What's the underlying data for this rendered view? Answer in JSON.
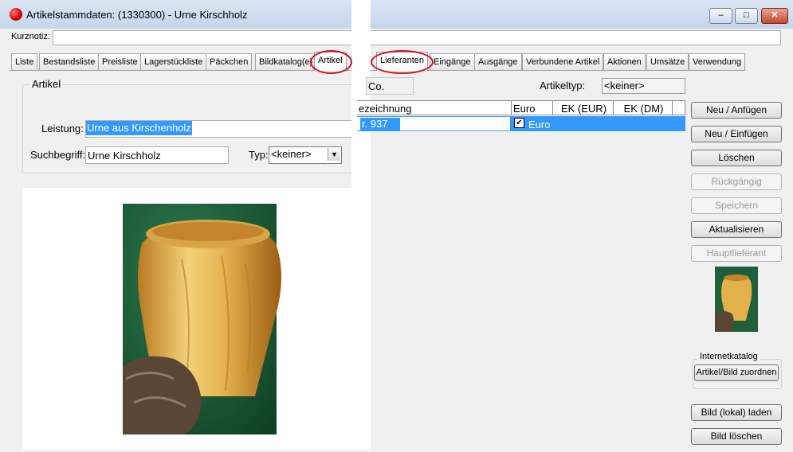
{
  "window": {
    "title": "Artikelstammdaten:  (1330300) - Urne Kirschholz",
    "controls": {
      "minimize": "–",
      "maximize": "□",
      "close": "✕"
    }
  },
  "kurznotiz": {
    "label": "Kurznotiz:",
    "value": ""
  },
  "tabs_left": [
    "Liste",
    "Bestandsliste",
    "Preisliste",
    "Lagerstückliste",
    "Päckchen",
    "Bildkatalog(e)",
    "Artikel"
  ],
  "tabs_right": [
    "Lieferanten",
    "Eingänge",
    "Ausgänge",
    "Verbundene Artikel",
    "Aktionen",
    "Umsätze",
    "Verwendung"
  ],
  "artikel": {
    "group_title": "Artikel",
    "leistung_label": "Leistung:",
    "leistung_value": "Urne aus Kirschenholz",
    "suchbegriff_label": "Suchbegriff:",
    "suchbegriff_value": "Urne Kirschholz",
    "typ_label": "Typ:",
    "typ_value": "<keiner>",
    "typ_arrow": "▼"
  },
  "lieferanten": {
    "co_label": "Co.",
    "artikeltyp_label": "Artikeltyp:",
    "artikeltyp_value": "<keiner>",
    "columns": [
      "ezeichnung",
      "Euro",
      "EK (EUR)",
      "EK (DM)"
    ],
    "rows": [
      {
        "bezeichnung": "r. 937",
        "euro_checked": "✔",
        "euro": "Euro"
      }
    ]
  },
  "buttons": {
    "neu_anfuegen": "Neu / Anfügen",
    "neu_einfuegen": "Neu / Einfügen",
    "loeschen": "Löschen",
    "rueckgaengig": "Rückgängig",
    "speichern": "Speichern",
    "aktualisieren": "Aktualisieren",
    "hauptlieferant": "Hauptlieferant",
    "internetkatalog_title": "Internetkatalog",
    "artikel_bild_zuordnen": "Artikel/Bild zuordnen",
    "bild_lokal_laden": "Bild (lokal) laden",
    "bild_loeschen": "Bild löschen"
  },
  "colors": {
    "selection": "#3399ff",
    "highlight_ring": "#d4101c",
    "urn_wood": "#e2b14a",
    "background_cloth": "#1f5f3a"
  }
}
